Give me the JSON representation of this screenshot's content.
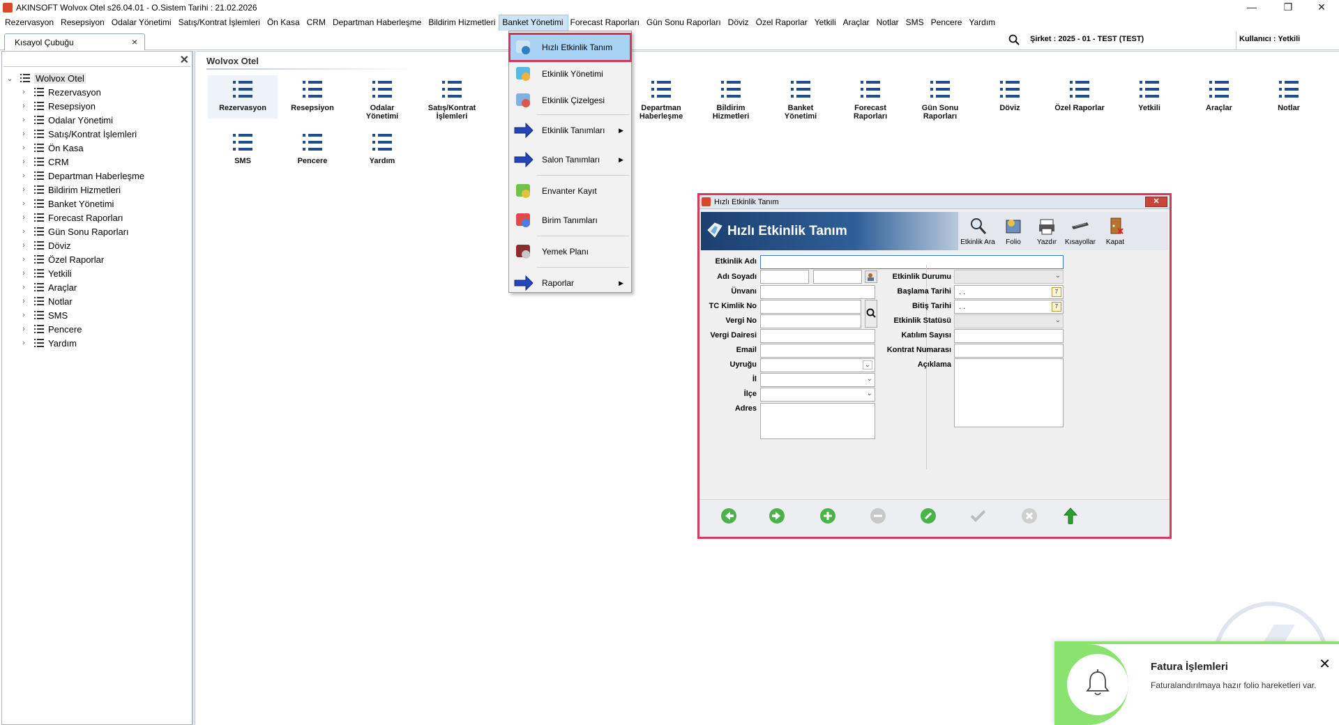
{
  "window": {
    "title": "AKINSOFT Wolvox Otel s26.04.01 - O.Sistem Tarihi : 21.02.2026",
    "minimize": "—",
    "restore": "❐",
    "close": "✕"
  },
  "menubar": {
    "items": [
      {
        "label": "Rezervasyon"
      },
      {
        "label": "Resepsiyon"
      },
      {
        "label": "Odalar Yönetimi"
      },
      {
        "label": "Satış/Kontrat İşlemleri"
      },
      {
        "label": "Ön Kasa"
      },
      {
        "label": "CRM"
      },
      {
        "label": "Departman Haberleşme"
      },
      {
        "label": "Bildirim Hizmetleri"
      },
      {
        "label": "Banket Yönetimi"
      },
      {
        "label": "Forecast Raporları"
      },
      {
        "label": "Gün Sonu Raporları"
      },
      {
        "label": "Döviz"
      },
      {
        "label": "Özel Raporlar"
      },
      {
        "label": "Yetkili"
      },
      {
        "label": "Araçlar"
      },
      {
        "label": "Notlar"
      },
      {
        "label": "SMS"
      },
      {
        "label": "Pencere"
      },
      {
        "label": "Yardım"
      }
    ],
    "active_index": 8
  },
  "tabs": {
    "shortcut_tab": "Kısayol Çubuğu",
    "shortcut_tab_close": "×"
  },
  "status": {
    "company": "Şirket : 2025 - 01 - TEST (TEST)",
    "user": "Kullanıcı : Yetkili"
  },
  "left_panel": {
    "close": "✕",
    "root": "Wolvox Otel",
    "items": [
      "Rezervasyon",
      "Resepsiyon",
      "Odalar Yönetimi",
      "Satış/Kontrat İşlemleri",
      "Ön Kasa",
      "CRM",
      "Departman Haberleşme",
      "Bildirim Hizmetleri",
      "Banket Yönetimi",
      "Forecast Raporları",
      "Gün Sonu Raporları",
      "Döviz",
      "Özel Raporlar",
      "Yetkili",
      "Araçlar",
      "Notlar",
      "SMS",
      "Pencere",
      "Yardım"
    ]
  },
  "main": {
    "title": "Wolvox Otel",
    "shortcuts_row1": [
      {
        "l1": "Rezervasyon",
        "l2": ""
      },
      {
        "l1": "Resepsiyon",
        "l2": ""
      },
      {
        "l1": "Odalar",
        "l2": "Yönetimi"
      },
      {
        "l1": "Satış/Kontrat",
        "l2": "İşlemleri"
      },
      {
        "l1": "Departman",
        "l2": "Haberleşme"
      },
      {
        "l1": "Bildirim",
        "l2": "Hizmetleri"
      },
      {
        "l1": "Banket",
        "l2": "Yönetimi"
      },
      {
        "l1": "Forecast",
        "l2": "Raporları"
      },
      {
        "l1": "Gün Sonu",
        "l2": "Raporları"
      },
      {
        "l1": "Döviz",
        "l2": ""
      },
      {
        "l1": "Özel Raporlar",
        "l2": ""
      },
      {
        "l1": "Yetkili",
        "l2": ""
      },
      {
        "l1": "Araçlar",
        "l2": ""
      },
      {
        "l1": "Notlar",
        "l2": ""
      }
    ],
    "shortcuts_row2": [
      {
        "l1": "SMS",
        "l2": ""
      },
      {
        "l1": "Pencere",
        "l2": ""
      },
      {
        "l1": "Yardım",
        "l2": ""
      }
    ]
  },
  "dropdown": {
    "items": [
      {
        "label": "Hızlı Etkinlik Tanım",
        "submenu": false,
        "icon": "quick-event-icon"
      },
      {
        "label": "Etkinlik Yönetimi",
        "submenu": false,
        "icon": "event-management-icon"
      },
      {
        "label": "Etkinlik Çizelgesi",
        "submenu": false,
        "icon": "event-schedule-icon"
      },
      {
        "label": "Etkinlik Tanımları",
        "submenu": true,
        "icon": "blue-arrow-icon"
      },
      {
        "label": "Salon Tanımları",
        "submenu": true,
        "icon": "blue-arrow-icon"
      },
      {
        "label": "Envanter Kayıt",
        "submenu": false,
        "icon": "inventory-icon"
      },
      {
        "label": "Birim Tanımları",
        "submenu": false,
        "icon": "units-icon"
      },
      {
        "label": "Yemek Planı",
        "submenu": false,
        "icon": "meal-plan-icon"
      },
      {
        "label": "Raporlar",
        "submenu": true,
        "icon": "blue-arrow-icon"
      }
    ],
    "submenu_arrow": "▶"
  },
  "dialog": {
    "window_title": "Hızlı Etkinlik Tanım",
    "header_title": "Hızlı Etkinlik Tanım",
    "close": "✕",
    "toolbar": [
      {
        "label": "Etkinlik Ara",
        "icon": "magnifier-icon"
      },
      {
        "label": "Folio",
        "icon": "folio-icon"
      },
      {
        "label": "Yazdır",
        "icon": "printer-icon"
      },
      {
        "label": "Kısayollar",
        "icon": "keyboard-icon"
      },
      {
        "label": "Kapat",
        "icon": "exit-door-icon"
      }
    ],
    "left_fields": {
      "etkinlik_adi": "Etkinlik Adı",
      "adi_soyadi": "Adı Soyadı",
      "unvani": "Ünvanı",
      "tc_kimlik": "TC Kimlik No",
      "vergi_no": "Vergi No",
      "vergi_dairesi": "Vergi Dairesi",
      "email": "Email",
      "uyrugu": "Uyruğu",
      "il": "İl",
      "ilce": "İlçe",
      "adres": "Adres"
    },
    "right_fields": {
      "etkinlik_durumu": "Etkinlik Durumu",
      "baslama_tarihi": "Başlama Tarihi",
      "bitis_tarihi": "Bitiş Tarihi",
      "etkinlik_statusu": "Etkinlik Statüsü",
      "katilim_sayisi": "Katılım Sayısı",
      "kontrat_numarasi": "Kontrat Numarası",
      "aciklama": "Açıklama"
    },
    "values": {
      "baslama_tarihi": ". .",
      "bitis_tarihi": ". ."
    },
    "nav_buttons": [
      "prev-icon",
      "next-icon",
      "add-icon",
      "remove-icon",
      "edit-icon",
      "confirm-icon",
      "cancel-icon",
      "up-icon"
    ]
  },
  "notification": {
    "title": "Fatura İşlemleri",
    "body": "Faturalandırılmaya hazır folio hareketleri var.",
    "close": "✕"
  },
  "colors": {
    "accent_red": "#d63a5b",
    "menu_highlight": "#a9d3f5",
    "header_blue": "#1c3f70",
    "list_icon_blue": "#1e4f8c",
    "notification_green": "#8be36f"
  }
}
